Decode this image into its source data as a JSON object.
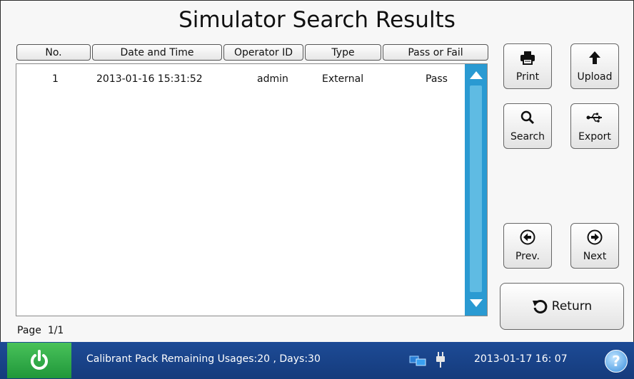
{
  "title": "Simulator Search Results",
  "table": {
    "columns": [
      "No.",
      "Date and Time",
      "Operator ID",
      "Type",
      "Pass or Fail"
    ],
    "rows": [
      {
        "no": "1",
        "datetime": "2013-01-16 15:31:52",
        "operator": "admin",
        "type": "External",
        "result": "Pass"
      }
    ]
  },
  "pagination": {
    "label": "Page",
    "value": "1/1"
  },
  "buttons": {
    "print": "Print",
    "upload": "Upload",
    "search": "Search",
    "export": "Export",
    "prev": "Prev.",
    "next": "Next",
    "return": "Return"
  },
  "status_bar": {
    "message": "Calibrant Pack Remaining Usages:20 , Days:30",
    "datetime": "2013-01-17  16: 07",
    "help": "?"
  },
  "colors": {
    "scrollbar": "#2a9ad2",
    "status_bar": "#1d4b96",
    "power_button": "#3cae4e"
  }
}
